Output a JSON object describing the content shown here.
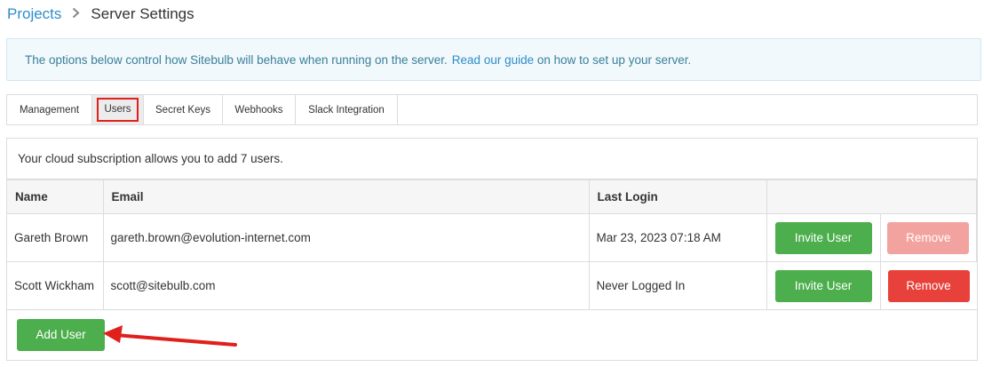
{
  "breadcrumb": {
    "parent": "Projects",
    "current": "Server Settings"
  },
  "info": {
    "text": "The options below control how Sitebulb will behave when running on the server.",
    "link": "Read our guide",
    "suffix": " on how to set up your server."
  },
  "tabs": [
    {
      "label": "Management",
      "active": false
    },
    {
      "label": "Users",
      "active": true
    },
    {
      "label": "Secret Keys",
      "active": false
    },
    {
      "label": "Webhooks",
      "active": false
    },
    {
      "label": "Slack Integration",
      "active": false
    }
  ],
  "users_panel": {
    "subscription_text": "Your cloud subscription allows you to add 7 users.",
    "columns": [
      "Name",
      "Email",
      "Last Login",
      ""
    ],
    "rows": [
      {
        "name": "Gareth Brown",
        "email": "gareth.brown@evolution-internet.com",
        "last_login": "Mar 23, 2023 07:18 AM",
        "invite_label": "Invite User",
        "remove_label": "Remove",
        "remove_disabled": true
      },
      {
        "name": "Scott Wickham",
        "email": "scott@sitebulb.com",
        "last_login": "Never Logged In",
        "invite_label": "Invite User",
        "remove_label": "Remove",
        "remove_disabled": false
      }
    ],
    "add_user_label": "Add User"
  },
  "colors": {
    "green": "#4cae4c",
    "red": "#e8413b",
    "red_disabled": "#f3a39f",
    "link": "#2e8cc9",
    "annotation": "#e0201b"
  },
  "icons": [
    "chevron-right-icon",
    "annotation-arrow"
  ]
}
